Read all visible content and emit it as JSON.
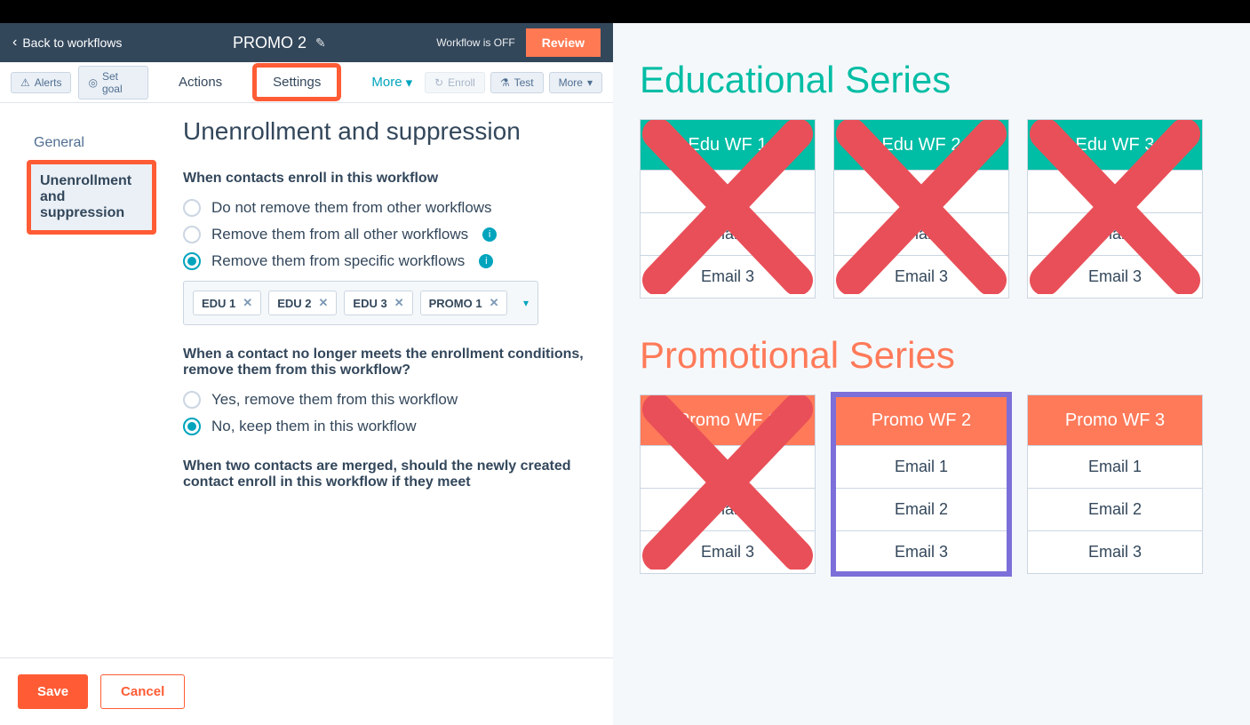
{
  "header": {
    "back_label": "Back to workflows",
    "title": "PROMO 2",
    "status": "Workflow is OFF",
    "review_label": "Review"
  },
  "tabbar": {
    "alerts": "Alerts",
    "set_goal": "Set goal",
    "tabs": [
      "Actions",
      "Settings"
    ],
    "more": "More",
    "enroll": "Enroll",
    "test": "Test",
    "more2": "More"
  },
  "sidenav": {
    "items": [
      "General",
      "Unenrollment and suppression"
    ]
  },
  "main": {
    "heading": "Unenrollment and suppression",
    "q1": "When contacts enroll in this workflow",
    "q1_opts": [
      "Do not remove them from other workflows",
      "Remove them from all other workflows",
      "Remove them from specific workflows"
    ],
    "tokens": [
      "EDU 1",
      "EDU 2",
      "EDU 3",
      "PROMO 1"
    ],
    "q2": "When a contact no longer meets the enrollment conditions, remove them from this workflow?",
    "q2_opts": [
      "Yes, remove them from this workflow",
      "No, keep them in this workflow"
    ],
    "q3": "When two contacts are merged, should the newly created contact enroll in this workflow if they meet"
  },
  "footer": {
    "save": "Save",
    "cancel": "Cancel"
  },
  "right": {
    "edu_title": "Educational Series",
    "promo_title": "Promotional Series",
    "edu_cards": [
      {
        "title": "Edu WF 1",
        "rows": [
          "Email 1",
          "Email 2",
          "Email 3"
        ],
        "crossed": true
      },
      {
        "title": "Edu WF 2",
        "rows": [
          "Email 1",
          "Email 2",
          "Email 3"
        ],
        "crossed": true
      },
      {
        "title": "Edu WF 3",
        "rows": [
          "Email 1",
          "Email 2",
          "Email 3"
        ],
        "crossed": true
      }
    ],
    "promo_cards": [
      {
        "title": "Promo WF 1",
        "rows": [
          "Email 1",
          "Email 2",
          "Email 3"
        ],
        "crossed": true
      },
      {
        "title": "Promo WF  2",
        "rows": [
          "Email 1",
          "Email 2",
          "Email 3"
        ],
        "crossed": false,
        "active": true
      },
      {
        "title": "Promo WF 3",
        "rows": [
          "Email 1",
          "Email 2",
          "Email 3"
        ],
        "crossed": false
      }
    ]
  }
}
